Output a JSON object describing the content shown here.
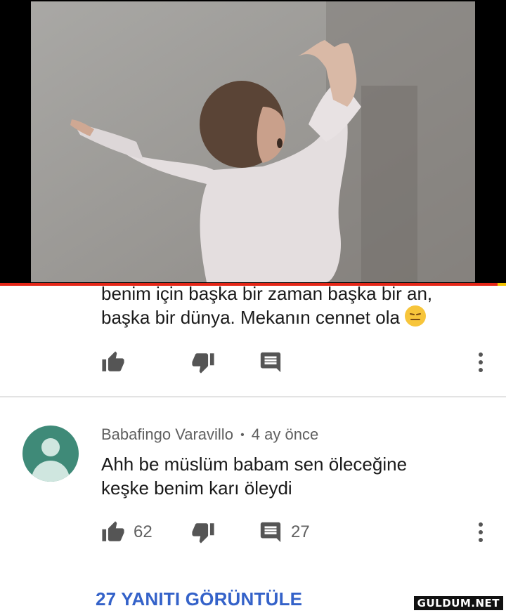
{
  "video": {
    "progress_fraction": 0.985
  },
  "comment_1": {
    "text_line_1": "benim için başka bir zaman başka bir an,",
    "text_line_2": "başka bir dünya. Mekanın cennet ola",
    "emoji": "expressionless-face-emoji"
  },
  "comment_2": {
    "author": "Babafingo Varavillo",
    "separator": "•",
    "time": "4 ay önce",
    "text_line_1": "Ahh be müslüm babam sen öleceğine",
    "text_line_2": "keşke benim karı öleydi",
    "likes": "62",
    "replies": "27"
  },
  "view_replies_label": "27 YANITI GÖRÜNTÜLE",
  "watermark": "GULDUM.NET",
  "colors": {
    "link": "#3462c9",
    "progress": "#e42617",
    "avatar": "#3f8a78"
  },
  "icons": [
    "thumbs-up-icon",
    "thumbs-down-icon",
    "reply-comment-icon",
    "more-vert-icon"
  ]
}
